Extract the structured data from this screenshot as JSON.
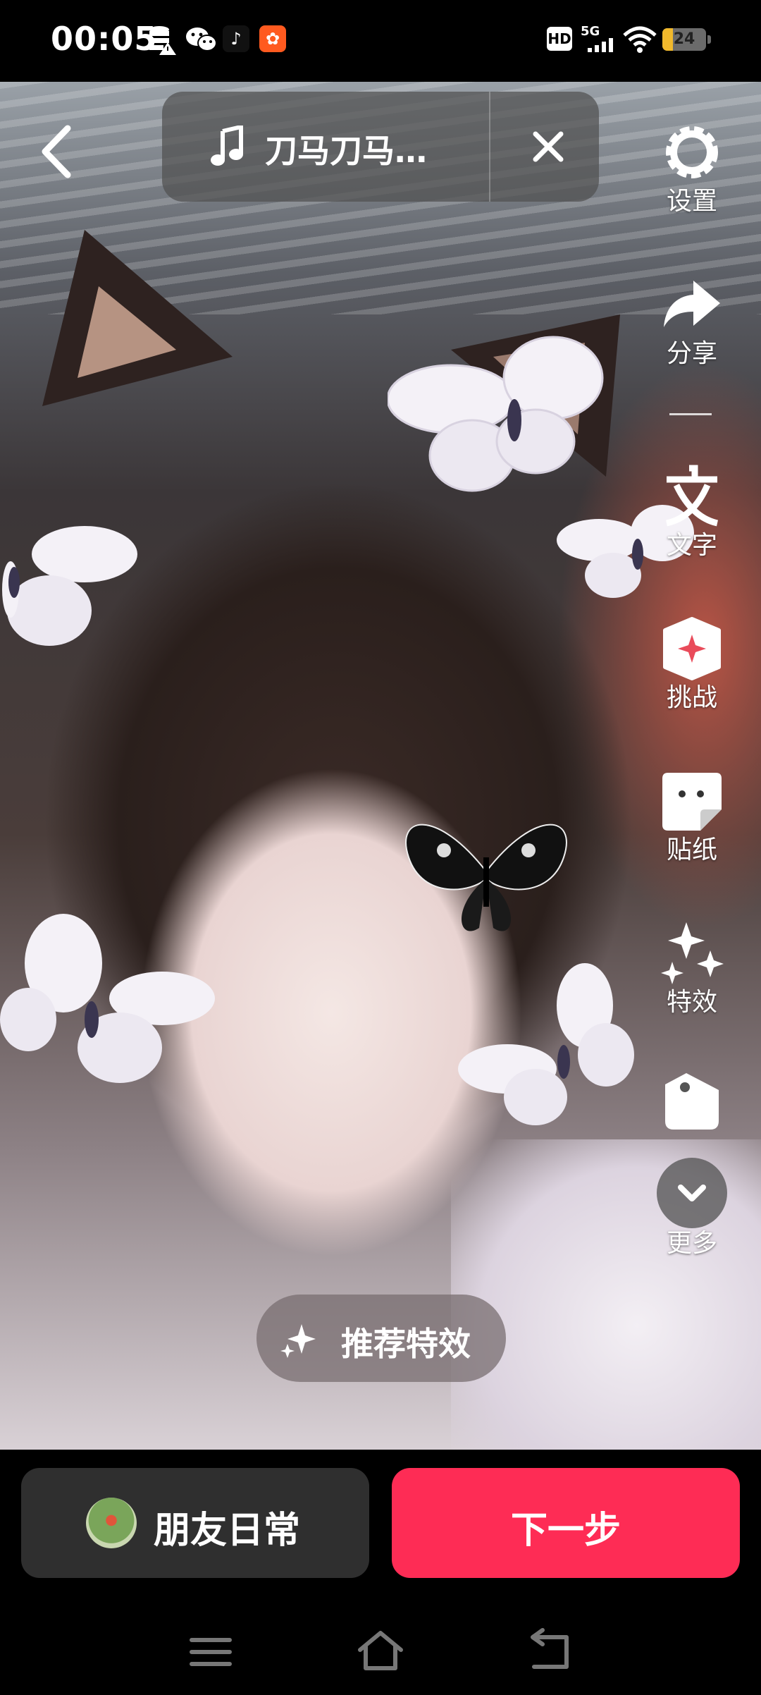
{
  "status_bar": {
    "time": "00:05",
    "hd_label": "HD",
    "network_label": "5G",
    "battery_level": "24",
    "battery_fraction": 0.24,
    "icons": [
      "database-warning-icon",
      "wechat-icon",
      "tiktok-icon",
      "kuaishou-icon",
      "wifi-icon",
      "signal-icon"
    ]
  },
  "header": {
    "music_title": "刀马刀马…"
  },
  "tools": [
    {
      "label": "设置",
      "icon": "gear-icon"
    },
    {
      "label": "分享",
      "icon": "share-arrow-icon"
    },
    {
      "label": "文字",
      "icon": "text-icon"
    },
    {
      "label": "挑战",
      "icon": "challenge-icon"
    },
    {
      "label": "贴纸",
      "icon": "sticker-icon"
    },
    {
      "label": "特效",
      "icon": "sparkle-icon"
    },
    {
      "label": "",
      "icon": "tag-icon"
    },
    {
      "label": "更多",
      "icon": "chevron-down-icon"
    }
  ],
  "recommend": {
    "label": "推荐特效"
  },
  "bottom": {
    "friend_label": "朋友日常",
    "next_label": "下一步"
  },
  "colors": {
    "accent": "#fe2c55",
    "secondary_button": "#2f2f2f"
  }
}
